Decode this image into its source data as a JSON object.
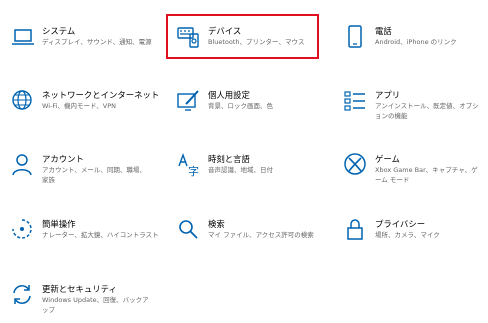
{
  "accent_color": "#0063b1",
  "selection_color": "#e01020",
  "tiles": [
    {
      "icon": "laptop-icon",
      "title": "システム",
      "desc": "ディスプレイ、サウンド、通知、電源"
    },
    {
      "icon": "keyboard-devices-icon",
      "title": "デバイス",
      "desc": "Bluetooth、プリンター、マウス"
    },
    {
      "icon": "phone-icon",
      "title": "電話",
      "desc": "Android、iPhone のリンク"
    },
    {
      "icon": "globe-icon",
      "title": "ネットワークとインターネット",
      "desc": "Wi-Fi、機内モード、VPN"
    },
    {
      "icon": "personalization-brush-icon",
      "title": "個人用設定",
      "desc": "背景、ロック画面、色"
    },
    {
      "icon": "apps-list-icon",
      "title": "アプリ",
      "desc": "アンインストール、既定値、オプションの機能"
    },
    {
      "icon": "person-icon",
      "title": "アカウント",
      "desc": "アカウント、メール、同期、職場、家族"
    },
    {
      "icon": "time-language-icon",
      "title": "時刻と言語",
      "desc": "音声認識、地域、日付"
    },
    {
      "icon": "xbox-icon",
      "title": "ゲーム",
      "desc": "Xbox Game Bar、キャプチャ、ゲーム モード"
    },
    {
      "icon": "ease-of-access-icon",
      "title": "簡単操作",
      "desc": "ナレーター、拡大鏡、ハイコントラスト"
    },
    {
      "icon": "search-icon",
      "title": "検索",
      "desc": "マイ ファイル、アクセス許可の検索"
    },
    {
      "icon": "lock-icon",
      "title": "プライバシー",
      "desc": "場所、カメラ、マイク"
    },
    {
      "icon": "update-sync-icon",
      "title": "更新とセキュリティ",
      "desc": "Windows Update、回復、バックアップ"
    }
  ]
}
